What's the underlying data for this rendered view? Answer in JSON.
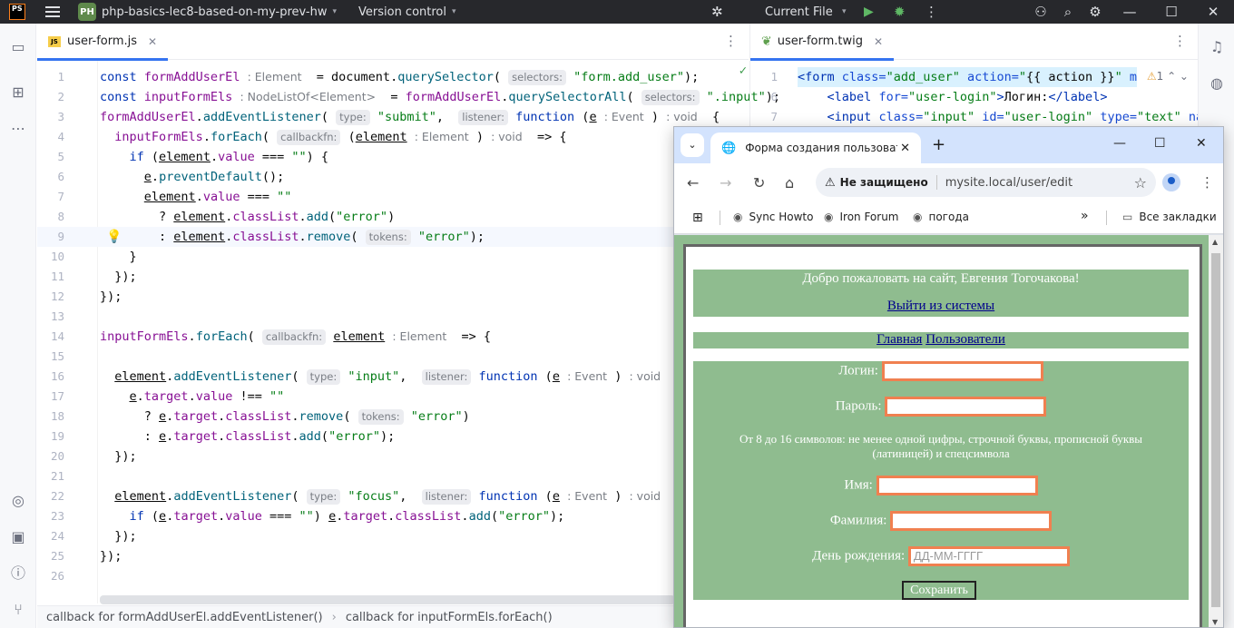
{
  "ide": {
    "logo": "PS",
    "project_badge": "PH",
    "project_name": "php-basics-lec8-based-on-my-prev-hw",
    "vcs": "Version control",
    "run_config": "Current File"
  },
  "left_tab": {
    "label": "user-form.js",
    "icon": "JS"
  },
  "right_tab": {
    "label": "user-form.twig"
  },
  "code_js": [
    {
      "n": "1"
    },
    {
      "n": "2"
    },
    {
      "n": "3"
    },
    {
      "n": "4"
    },
    {
      "n": "5"
    },
    {
      "n": "6"
    },
    {
      "n": "7"
    },
    {
      "n": "8"
    },
    {
      "n": "9"
    },
    {
      "n": "10"
    },
    {
      "n": "11"
    },
    {
      "n": "12"
    },
    {
      "n": "13"
    },
    {
      "n": "14"
    },
    {
      "n": "15"
    },
    {
      "n": "16"
    },
    {
      "n": "17"
    },
    {
      "n": "18"
    },
    {
      "n": "19"
    },
    {
      "n": "20"
    },
    {
      "n": "21"
    },
    {
      "n": "22"
    },
    {
      "n": "23"
    },
    {
      "n": "24"
    },
    {
      "n": "25"
    },
    {
      "n": "26"
    }
  ],
  "twig_lines": [
    {
      "n": "1"
    },
    {
      "n": "6"
    },
    {
      "n": "7"
    }
  ],
  "twig_warnings": "1",
  "statusbar": {
    "crumb1": "callback for formAddUserEl.addEventListener()",
    "crumb2": "callback for inputFormEls.forEach()"
  },
  "browser": {
    "tab_title": "Форма создания пользователя",
    "security_label": "Не защищено",
    "url": "mysite.local/user/edit",
    "bookmarks": [
      "Sync Howto",
      "Iron Forum",
      "погода"
    ],
    "all_bookmarks": "Все закладки"
  },
  "page": {
    "welcome": "Добро пожаловать на сайт, Евгения Тогочакова!",
    "logout": "Выйти из системы",
    "nav_home": "Главная",
    "nav_users": "Пользователи",
    "login_label": "Логин:",
    "password_label": "Пароль:",
    "password_hint": "От 8 до 16 символов: не менее одной цифры, строчной буквы, прописной буквы (латиницей) и спецсимвола",
    "name_label": "Имя:",
    "lastname_label": "Фамилия:",
    "birthday_label": "День рождения:",
    "birthday_placeholder": "ДД-ММ-ГГГГ",
    "submit": "Сохранить"
  },
  "colors": {
    "page_bg": "#8fbc8f",
    "input_border": "#f08050",
    "link": "#00008b"
  }
}
